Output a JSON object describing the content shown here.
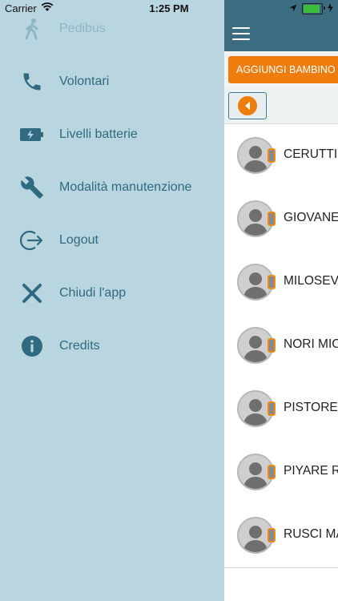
{
  "status_bar": {
    "carrier": "Carrier",
    "time": "1:25 PM",
    "battery_level": 0.9
  },
  "drawer": {
    "items": [
      {
        "label": "Pedibus",
        "icon": "walking-person-icon",
        "disabled": true
      },
      {
        "label": "Volontari",
        "icon": "phone-icon"
      },
      {
        "label": "Livelli batterie",
        "icon": "battery-charging-icon"
      },
      {
        "label": "Modalità manutenzione",
        "icon": "wrench-icon"
      },
      {
        "label": "Logout",
        "icon": "logout-icon"
      },
      {
        "label": "Chiudi l'app",
        "icon": "close-icon"
      },
      {
        "label": "Credits",
        "icon": "info-icon"
      }
    ]
  },
  "panel": {
    "add_button_label": "AGGIUNGI BAMBINO",
    "children": [
      {
        "name": "CERUTTI"
      },
      {
        "name": "GIOVANE"
      },
      {
        "name": "MILOSEV"
      },
      {
        "name": "NORI MIC"
      },
      {
        "name": "PISTORE"
      },
      {
        "name": "PIYARE R"
      },
      {
        "name": "RUSCI MA"
      }
    ]
  },
  "colors": {
    "accent": "#ee7d0d",
    "header": "#3c6c80",
    "drawer_bg": "#b9d5df",
    "drawer_text": "#2f6a80"
  }
}
